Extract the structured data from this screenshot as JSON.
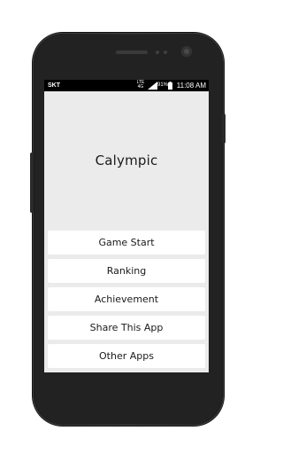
{
  "status_bar": {
    "carrier": "SKT",
    "network": "LTE",
    "network_sub": "4G",
    "battery": "91%",
    "time": "11:08 AM",
    "icons": [
      "signal-icon",
      "battery-icon"
    ]
  },
  "app": {
    "title": "Calympic"
  },
  "menu": {
    "items": [
      {
        "label": "Game Start"
      },
      {
        "label": "Ranking"
      },
      {
        "label": "Achievement"
      },
      {
        "label": "Share This App"
      },
      {
        "label": "Other Apps"
      }
    ]
  },
  "colors": {
    "screen_bg": "#ebebeb",
    "button_bg": "#ffffff",
    "phone_body": "#222222",
    "status_bar": "#000000"
  }
}
